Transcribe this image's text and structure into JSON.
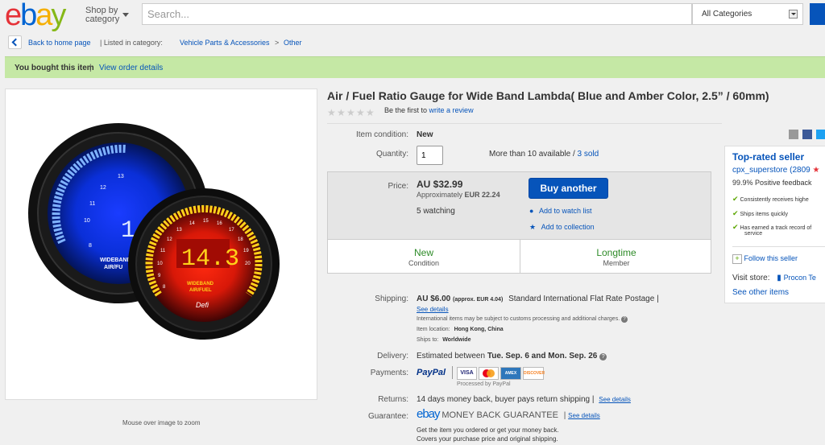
{
  "header": {
    "logo": {
      "e": "e",
      "b": "b",
      "a": "a",
      "y": "y"
    },
    "shop_by": "Shop by",
    "category": "category",
    "search_placeholder": "Search...",
    "category_select": "All Categories"
  },
  "breadcrumb": {
    "back": "Back to home page",
    "listed_in": "| Listed in category:",
    "cat1": "Vehicle Parts & Accessories",
    "sep": ">",
    "cat2": "Other"
  },
  "bought_bar": {
    "message": "You bought this item",
    "sep": "|",
    "link": "View order details"
  },
  "image": {
    "zoom_hint": "Mouse over image to zoom",
    "blue_reading": "14",
    "red_reading": "14.3",
    "blue_label1": "WIDEBAND",
    "blue_label2": "AIR/FU",
    "red_label1": "WIDEBAND",
    "red_label2": "AIR/FUEL",
    "brand": "Defi",
    "blue_ticks": [
      "10",
      "11",
      "12",
      "13",
      "8"
    ],
    "red_ticks": [
      "10",
      "11",
      "12",
      "13",
      "14",
      "15",
      "16",
      "17",
      "18",
      "19",
      "20",
      "8",
      "9"
    ],
    "colors": {
      "blue": "#2a5bff",
      "red": "#ff3a1a",
      "amber": "#ffd21a"
    }
  },
  "title": "Air / Fuel Ratio Gauge for Wide Band Lambda( Blue and Amber Color, 2.5” / 60mm)",
  "reviews": {
    "prefix": "Be the first to",
    "link": "write a review"
  },
  "condition": {
    "label": "Item condition:",
    "value": "New"
  },
  "quantity": {
    "label": "Quantity:",
    "value": "1",
    "available": "More than 10 available /",
    "sold": "3 sold"
  },
  "price": {
    "label": "Price:",
    "value": "AU $32.99",
    "approx": "Approximately",
    "approx_eur": "EUR 22.24",
    "watching": "5 watching",
    "buy": "Buy another",
    "watch": "Add to watch list",
    "collection": "Add to collection"
  },
  "stats": [
    {
      "big": "New",
      "small": "Condition"
    },
    {
      "big": "Longtime",
      "small": "Member"
    }
  ],
  "seller": {
    "heading": "Top-rated seller",
    "name": "cpx_superstore",
    "score": "(2809",
    "positive": "99.9% Positive feedback",
    "points": [
      "Consistently receives highe",
      "Ships items quickly",
      "Has earned a track record of",
      "service"
    ],
    "follow": "Follow this seller",
    "visit": "Visit store:",
    "store": "Procon Te",
    "other": "See other items"
  },
  "shipping": {
    "label": "Shipping:",
    "cost": "AU $6.00",
    "approx": "(approx. EUR 4.04)",
    "method": "Standard International Flat Rate Postage |",
    "details": "See details",
    "note": "International items may be subject to customs processing and additional charges.",
    "location_label": "Item location:",
    "location": "Hong Kong, China",
    "ships_to_label": "Ships to:",
    "ships_to": "Worldwide"
  },
  "delivery": {
    "label": "Delivery:",
    "prefix": "Estimated between",
    "dates": "Tue. Sep. 6 and Mon. Sep. 26"
  },
  "payments": {
    "label": "Payments:",
    "paypal": "PayPal",
    "cards": [
      "VISA",
      "MC",
      "AMEX",
      "DISCOVER"
    ],
    "processed": "Processed by PayPal"
  },
  "returns": {
    "label": "Returns:",
    "text": "14 days money back, buyer pays return shipping |",
    "link": "See details"
  },
  "guarantee": {
    "label": "Guarantee:",
    "logo": "ebay",
    "text": "MONEY BACK GUARANTEE",
    "sep": "|",
    "link": "See details",
    "line1": "Get the item you ordered or get your money back.",
    "line2": "Covers your purchase price and original shipping."
  }
}
